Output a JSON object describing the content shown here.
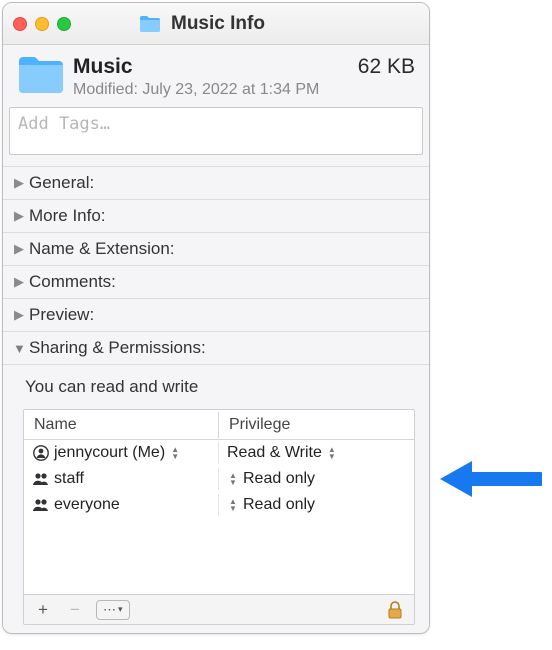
{
  "window": {
    "title": "Music Info"
  },
  "folder": {
    "name": "Music",
    "size": "62 KB",
    "modified": "Modified:  July 23, 2022 at 1:34 PM"
  },
  "tags": {
    "placeholder": "Add Tags…",
    "value": ""
  },
  "sections": {
    "general": "General:",
    "moreinfo": "More Info:",
    "nameext": "Name & Extension:",
    "comments": "Comments:",
    "preview": "Preview:",
    "sharing": "Sharing & Permissions:"
  },
  "sharing": {
    "hint": "You can read and write",
    "headers": {
      "name": "Name",
      "privilege": "Privilege"
    },
    "rows": [
      {
        "user": "jennycourt (Me)",
        "priv": "Read & Write",
        "icon": "person"
      },
      {
        "user": "staff",
        "priv": "Read only",
        "icon": "group"
      },
      {
        "user": "everyone",
        "priv": "Read only",
        "icon": "group"
      }
    ]
  },
  "footer": {
    "add": "+",
    "remove": "−",
    "action": "⋯"
  }
}
